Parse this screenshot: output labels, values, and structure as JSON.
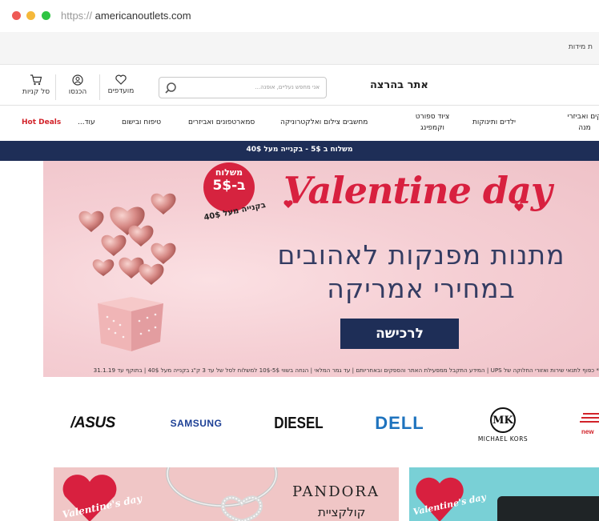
{
  "browser": {
    "url_protocol": "https://",
    "url_host": "americanoutlets.com"
  },
  "topbar": {
    "text": "ת מידות"
  },
  "header": {
    "site_title": "אתר בהרצה",
    "search_placeholder": "אני מחפש נעליים, אופנה...",
    "favorites_label": "מועדפים",
    "login_label": "הכנסו",
    "cart_label": "סל קניות"
  },
  "nav": {
    "items": [
      {
        "line1": "קים ואביזרי",
        "line2": "מנה"
      },
      {
        "line1": "ילדים ותינוקות",
        "line2": ""
      },
      {
        "line1": "ציוד ספורט",
        "line2": "וקמפינג"
      },
      {
        "line1": "מחשבים צילום ואלקטרוניקה",
        "line2": ""
      },
      {
        "line1": "סמארטפונים ואביזרים",
        "line2": ""
      },
      {
        "line1": "טיפוח ובישום",
        "line2": ""
      },
      {
        "line1": "עוד...",
        "line2": ""
      }
    ],
    "hot_deals": "Hot Deals"
  },
  "shipping_bar": {
    "text": "משלוח ב 5$ - בקנייה מעל 40$"
  },
  "hero": {
    "badge_line1": "משלוח",
    "badge_line2": "ב-5$",
    "badge_sub": "בקנייה מעל 40$",
    "title": "Valentine day",
    "line1": "מתנות מפנקות לאהובים",
    "line2": "במחירי אמריקה",
    "cta_label": "לרכישה",
    "fine_print": "* כפוף לתנאי שירות ואזורי החלוקה של UPS | המידע התקבל ממפעילת האתר והספקים ובאחריותם | עד גמר המלאי | הנחה בשווי 5$-10$ למשלוח לסל של עד 3 ק\"ג בקנייה מעל 40$ | בתוקף עד 31.1.19",
    "colors": {
      "accent_red": "#d8203f",
      "navy": "#1e2e57",
      "bg_pink": "#f4cdd2"
    }
  },
  "brands": {
    "asus": "/ASUS",
    "samsung": "SAMSUNG",
    "diesel": "DIESEL",
    "dell": "DELL",
    "mk_monogram": "MK",
    "mk_name": "MICHAEL KORS",
    "new_balance": "new"
  },
  "promo_left": {
    "brand": "PANDORA",
    "subtitle": "קולקציית",
    "tag": "Valentine's day"
  },
  "promo_right": {
    "tag": "Valentine's day"
  }
}
